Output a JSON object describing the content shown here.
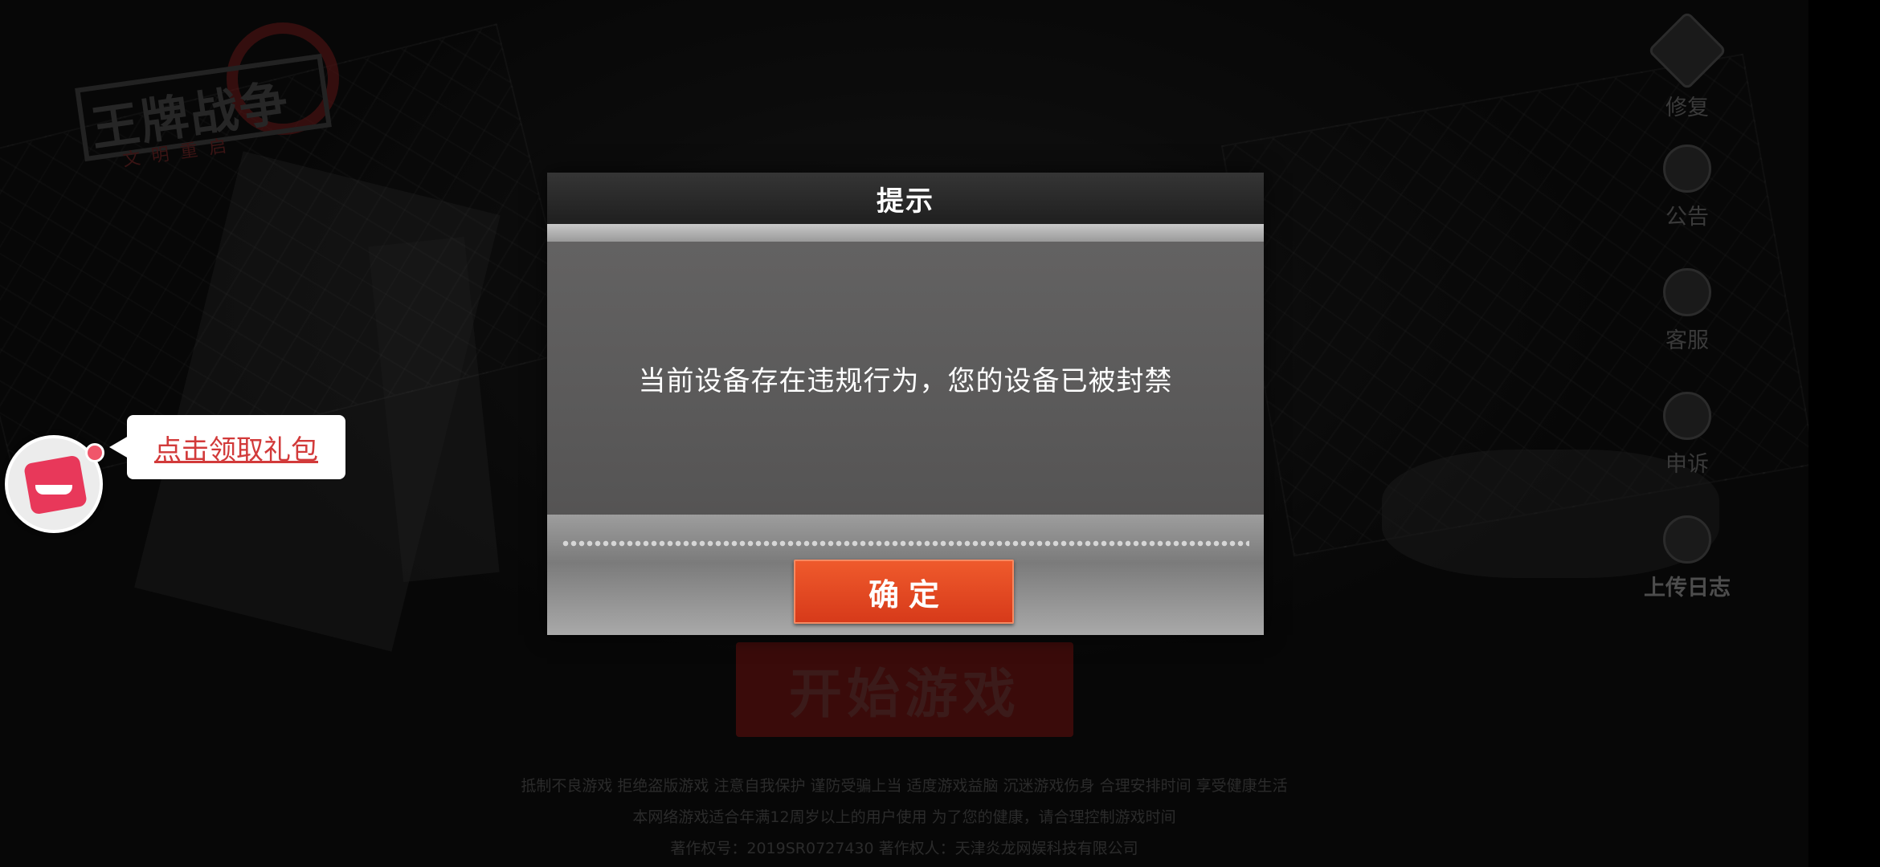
{
  "game": {
    "logo_text": "王牌战争",
    "logo_subtext": "文明重启",
    "start_button_label": "开始游戏"
  },
  "side_menu": [
    {
      "label": "修复",
      "icon": "gear-icon"
    },
    {
      "label": "公告",
      "icon": "notice-icon"
    },
    {
      "label": "客服",
      "icon": "headset-icon"
    },
    {
      "label": "申诉",
      "icon": "headset-icon"
    },
    {
      "label": "上传日志",
      "icon": "upload-icon"
    }
  ],
  "gift": {
    "label": "点击领取礼包",
    "icon": "gift-mascot-icon"
  },
  "dialog": {
    "title": "提示",
    "message": "当前设备存在违规行为，您的设备已被封禁",
    "confirm_label": "确定"
  },
  "footer": {
    "line1": "抵制不良游戏 拒绝盗版游戏 注意自我保护 谨防受骗上当 适度游戏益脑 沉迷游戏伤身 合理安排时间 享受健康生活",
    "line2": "本网络游戏适合年满12周岁以上的用户使用  为了您的健康，请合理控制游戏时间",
    "line3": "著作权号：2019SR0727430      著作权人：天津炎龙网娱科技有限公司"
  },
  "colors": {
    "confirm_button": "#e04a22",
    "gift_label": "#d23a3a",
    "dialog_body": "#5a5959"
  }
}
